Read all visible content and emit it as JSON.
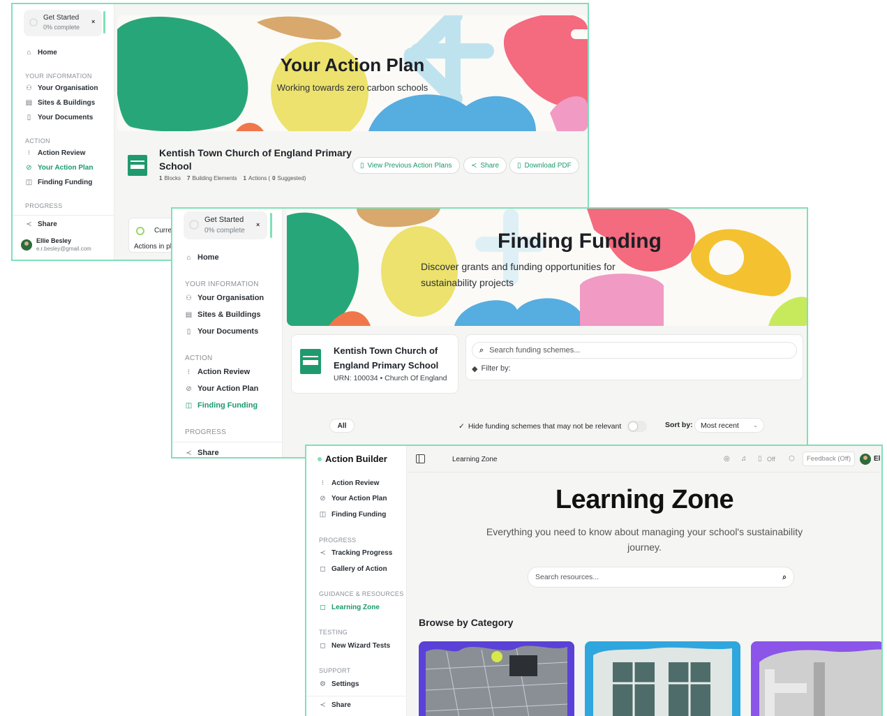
{
  "get_started": {
    "title": "Get Started",
    "progress_text": "0% complete",
    "close": "×"
  },
  "nav": {
    "home": "Home",
    "your_information_label": "YOUR INFORMATION",
    "your_organisation": "Your Organisation",
    "sites_buildings": "Sites & Buildings",
    "your_documents": "Your Documents",
    "action_label": "ACTION",
    "action_review": "Action Review",
    "your_action_plan": "Your Action Plan",
    "finding_funding": "Finding Funding",
    "progress_label": "PROGRESS",
    "tracking_progress": "Tracking Progress",
    "gallery_of_action": "Gallery of Action",
    "guidance_label": "GUIDANCE & RESOURCES",
    "learning_zone": "Learning Zone",
    "testing_label": "TESTING",
    "new_wizard_tests": "New Wizard Tests",
    "support_label": "SUPPORT",
    "settings": "Settings",
    "share": "Share"
  },
  "user": {
    "name": "Ellie Besley",
    "email": "e.r.besley@gmail.com"
  },
  "action_plan_screen": {
    "hero_title": "Your Action Plan",
    "hero_subtitle": "Working towards zero carbon schools",
    "school_name_line1": "Kentish Town Church of England Primary",
    "school_name_line2": "School",
    "stats": {
      "blocks": "1",
      "blocks_label": "Blocks",
      "elements": "7",
      "elements_label": "Building Elements",
      "actions": "1",
      "actions_label": "Actions (",
      "suggested": "0",
      "suggested_label": "Suggested)"
    },
    "buttons": {
      "view_previous": "View Previous Action Plans",
      "share": "Share",
      "download_pdf": "Download PDF"
    },
    "current_label": "Curren",
    "actions_in_text": "Actions in pl"
  },
  "funding_screen": {
    "hero_title": "Finding Funding",
    "hero_subtitle_line1": "Discover grants and funding opportunities for",
    "hero_subtitle_line2": "sustainability projects",
    "school_name_line1": "Kentish Town Church of",
    "school_name_line2": "England Primary School",
    "urn_text": "URN: 100034 • Church Of England",
    "search_placeholder": "Search funding schemes...",
    "filter_label": "Filter by:",
    "tab_all": "All",
    "hide_toggle_label": "Hide funding schemes that may not be relevant",
    "hide_toggle_on": false,
    "sort_label": "Sort by:",
    "sort_value": "Most recent"
  },
  "learning_screen": {
    "app_name": "Action Builder",
    "breadcrumb": "Learning Zone",
    "top_off_label": "Off",
    "feedback_label": "Feedback (Off)",
    "user_initials": "El",
    "hero_title": "Learning Zone",
    "hero_subtitle_line1": "Everything you need to know about managing your school's sustainability",
    "hero_subtitle_line2": "journey.",
    "search_placeholder": "Search resources...",
    "browse_heading": "Browse by Category"
  },
  "colors": {
    "accent_green": "#1a9a6c",
    "border_mint": "#7fe0b8",
    "blob_green": "#27a779",
    "blob_yellow": "#ece26d",
    "blob_lightblue": "#bfe3ee",
    "blob_pink": "#f46a7e",
    "blob_blue": "#56ade0",
    "blob_tan": "#d8a86c",
    "blob_orange": "#f0774a"
  }
}
